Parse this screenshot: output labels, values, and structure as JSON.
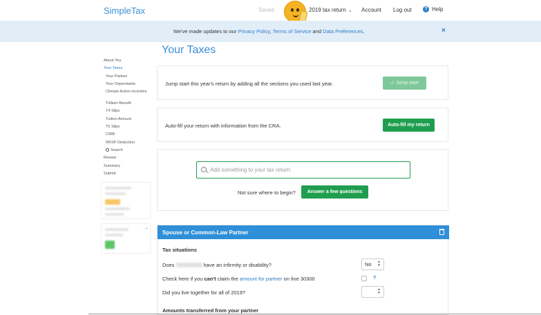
{
  "header": {
    "logo": "SimpleTax",
    "saved": "Saved",
    "tax_year": "2019 tax return",
    "account": "Account",
    "logout": "Log out",
    "help": "Help"
  },
  "banner": {
    "prefix": "We've made updates to our ",
    "privacy": "Privacy Policy",
    "comma": ", ",
    "terms": "Terms of Service",
    "and": " and ",
    "data_prefs": "Data Preferences",
    "suffix": ".",
    "close": "×"
  },
  "sidebar": {
    "items": [
      {
        "label": "About You"
      },
      {
        "label": "Your Taxes"
      },
      {
        "label": "Your Partner"
      },
      {
        "label": "Your Dependants"
      },
      {
        "label": "Climate Action Incentive"
      },
      {
        "label": "Trillium Benefit"
      },
      {
        "label": "T4 Slips"
      },
      {
        "label": "Tuition Amount"
      },
      {
        "label": "T5 Slips"
      },
      {
        "label": "CWB"
      },
      {
        "label": "RRSP Deduction"
      },
      {
        "label": "Search"
      },
      {
        "label": "Review"
      },
      {
        "label": "Summary"
      },
      {
        "label": "Submit"
      }
    ]
  },
  "main": {
    "title": "Your Taxes",
    "jumpstart": {
      "text": "Jump start this year's return by adding all the sections you used last year.",
      "button": "Jump start"
    },
    "autofill": {
      "text": "Auto-fill your return with information from the CRA.",
      "button": "Auto-fill my return"
    },
    "search": {
      "placeholder": "Add something to your tax return",
      "not_sure": "Not sure where to begin?",
      "button": "Answer a few questions"
    },
    "spouse": {
      "title": "Spouse or Common-Law Partner",
      "tax_situations": "Tax situations",
      "q1_prefix": "Does",
      "q1_suffix": "have an infirmity or disability?",
      "q1_value": "No",
      "q2_a": "Check here if you ",
      "q2_b": "can't",
      "q2_c": " claim the ",
      "q2_link": "amount for partner",
      "q2_d": " on line 30300",
      "q2_help": "?",
      "q3": "Did you live together for all of 2019?",
      "q3_value": "",
      "amounts_heading": "Amounts transferred from your partner"
    }
  },
  "colors": {
    "brand_blue": "#3a8fd6",
    "green": "#1f9e4f",
    "banner_bg": "#e1eef8",
    "spouse_header": "#2f8fd8"
  }
}
